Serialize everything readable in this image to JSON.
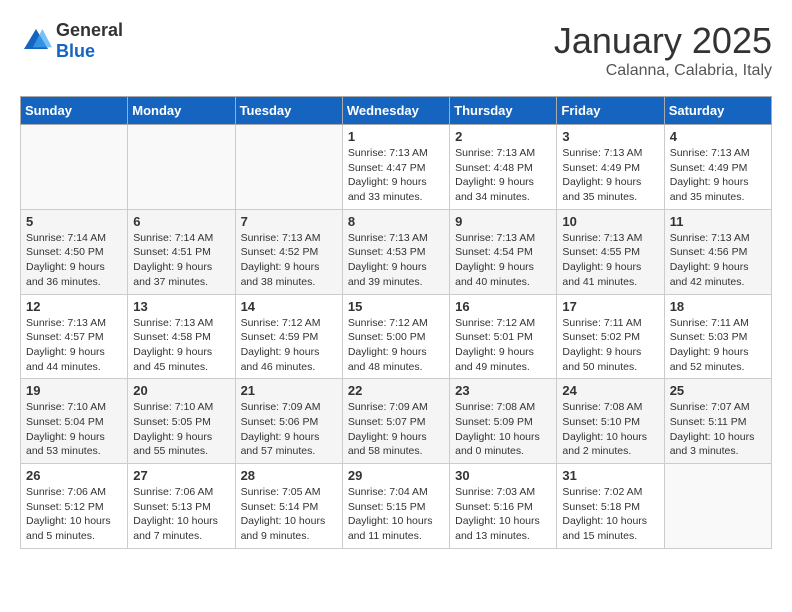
{
  "logo": {
    "general": "General",
    "blue": "Blue"
  },
  "title": "January 2025",
  "subtitle": "Calanna, Calabria, Italy",
  "weekdays": [
    "Sunday",
    "Monday",
    "Tuesday",
    "Wednesday",
    "Thursday",
    "Friday",
    "Saturday"
  ],
  "weeks": [
    [
      {
        "day": "",
        "info": ""
      },
      {
        "day": "",
        "info": ""
      },
      {
        "day": "",
        "info": ""
      },
      {
        "day": "1",
        "info": "Sunrise: 7:13 AM\nSunset: 4:47 PM\nDaylight: 9 hours and 33 minutes."
      },
      {
        "day": "2",
        "info": "Sunrise: 7:13 AM\nSunset: 4:48 PM\nDaylight: 9 hours and 34 minutes."
      },
      {
        "day": "3",
        "info": "Sunrise: 7:13 AM\nSunset: 4:49 PM\nDaylight: 9 hours and 35 minutes."
      },
      {
        "day": "4",
        "info": "Sunrise: 7:13 AM\nSunset: 4:49 PM\nDaylight: 9 hours and 35 minutes."
      }
    ],
    [
      {
        "day": "5",
        "info": "Sunrise: 7:14 AM\nSunset: 4:50 PM\nDaylight: 9 hours and 36 minutes."
      },
      {
        "day": "6",
        "info": "Sunrise: 7:14 AM\nSunset: 4:51 PM\nDaylight: 9 hours and 37 minutes."
      },
      {
        "day": "7",
        "info": "Sunrise: 7:13 AM\nSunset: 4:52 PM\nDaylight: 9 hours and 38 minutes."
      },
      {
        "day": "8",
        "info": "Sunrise: 7:13 AM\nSunset: 4:53 PM\nDaylight: 9 hours and 39 minutes."
      },
      {
        "day": "9",
        "info": "Sunrise: 7:13 AM\nSunset: 4:54 PM\nDaylight: 9 hours and 40 minutes."
      },
      {
        "day": "10",
        "info": "Sunrise: 7:13 AM\nSunset: 4:55 PM\nDaylight: 9 hours and 41 minutes."
      },
      {
        "day": "11",
        "info": "Sunrise: 7:13 AM\nSunset: 4:56 PM\nDaylight: 9 hours and 42 minutes."
      }
    ],
    [
      {
        "day": "12",
        "info": "Sunrise: 7:13 AM\nSunset: 4:57 PM\nDaylight: 9 hours and 44 minutes."
      },
      {
        "day": "13",
        "info": "Sunrise: 7:13 AM\nSunset: 4:58 PM\nDaylight: 9 hours and 45 minutes."
      },
      {
        "day": "14",
        "info": "Sunrise: 7:12 AM\nSunset: 4:59 PM\nDaylight: 9 hours and 46 minutes."
      },
      {
        "day": "15",
        "info": "Sunrise: 7:12 AM\nSunset: 5:00 PM\nDaylight: 9 hours and 48 minutes."
      },
      {
        "day": "16",
        "info": "Sunrise: 7:12 AM\nSunset: 5:01 PM\nDaylight: 9 hours and 49 minutes."
      },
      {
        "day": "17",
        "info": "Sunrise: 7:11 AM\nSunset: 5:02 PM\nDaylight: 9 hours and 50 minutes."
      },
      {
        "day": "18",
        "info": "Sunrise: 7:11 AM\nSunset: 5:03 PM\nDaylight: 9 hours and 52 minutes."
      }
    ],
    [
      {
        "day": "19",
        "info": "Sunrise: 7:10 AM\nSunset: 5:04 PM\nDaylight: 9 hours and 53 minutes."
      },
      {
        "day": "20",
        "info": "Sunrise: 7:10 AM\nSunset: 5:05 PM\nDaylight: 9 hours and 55 minutes."
      },
      {
        "day": "21",
        "info": "Sunrise: 7:09 AM\nSunset: 5:06 PM\nDaylight: 9 hours and 57 minutes."
      },
      {
        "day": "22",
        "info": "Sunrise: 7:09 AM\nSunset: 5:07 PM\nDaylight: 9 hours and 58 minutes."
      },
      {
        "day": "23",
        "info": "Sunrise: 7:08 AM\nSunset: 5:09 PM\nDaylight: 10 hours and 0 minutes."
      },
      {
        "day": "24",
        "info": "Sunrise: 7:08 AM\nSunset: 5:10 PM\nDaylight: 10 hours and 2 minutes."
      },
      {
        "day": "25",
        "info": "Sunrise: 7:07 AM\nSunset: 5:11 PM\nDaylight: 10 hours and 3 minutes."
      }
    ],
    [
      {
        "day": "26",
        "info": "Sunrise: 7:06 AM\nSunset: 5:12 PM\nDaylight: 10 hours and 5 minutes."
      },
      {
        "day": "27",
        "info": "Sunrise: 7:06 AM\nSunset: 5:13 PM\nDaylight: 10 hours and 7 minutes."
      },
      {
        "day": "28",
        "info": "Sunrise: 7:05 AM\nSunset: 5:14 PM\nDaylight: 10 hours and 9 minutes."
      },
      {
        "day": "29",
        "info": "Sunrise: 7:04 AM\nSunset: 5:15 PM\nDaylight: 10 hours and 11 minutes."
      },
      {
        "day": "30",
        "info": "Sunrise: 7:03 AM\nSunset: 5:16 PM\nDaylight: 10 hours and 13 minutes."
      },
      {
        "day": "31",
        "info": "Sunrise: 7:02 AM\nSunset: 5:18 PM\nDaylight: 10 hours and 15 minutes."
      },
      {
        "day": "",
        "info": ""
      }
    ]
  ]
}
